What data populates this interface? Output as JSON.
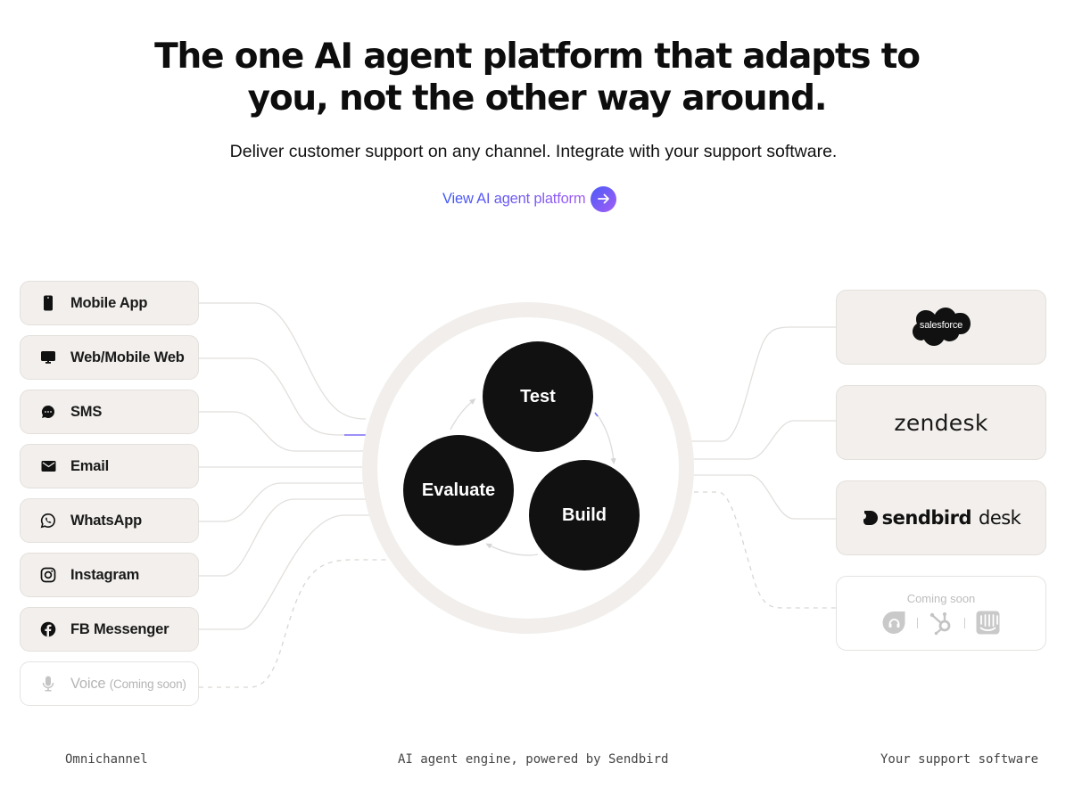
{
  "hero": {
    "title_line1": "The one AI agent platform that adapts to",
    "title_line2": "you, not the other way around.",
    "subtitle": "Deliver customer support on any channel. Integrate with your support software.",
    "cta_label": "View AI agent platform",
    "cta_icon": "arrow-right-icon",
    "cta_gradient": [
      "#3b55f6",
      "#a25cf5"
    ]
  },
  "channels": [
    {
      "label": "Mobile App",
      "icon": "mobile-phone-icon"
    },
    {
      "label": "Web/Mobile Web",
      "icon": "monitor-icon"
    },
    {
      "label": "SMS",
      "icon": "chat-bubble-icon"
    },
    {
      "label": "Email",
      "icon": "envelope-icon"
    },
    {
      "label": "WhatsApp",
      "icon": "whatsapp-icon"
    },
    {
      "label": "Instagram",
      "icon": "instagram-icon"
    },
    {
      "label": "FB Messenger",
      "icon": "facebook-icon"
    },
    {
      "label": "Voice",
      "suffix": "(Coming soon)",
      "icon": "microphone-icon",
      "coming_soon": true
    }
  ],
  "engine": {
    "nodes": [
      "Test",
      "Build",
      "Evaluate"
    ],
    "ring_color": "#f1eeeb",
    "node_color": "#111111"
  },
  "vendors": [
    {
      "label": "salesforce",
      "icon": "salesforce-logo"
    },
    {
      "label": "zendesk",
      "icon": "zendesk-logo"
    },
    {
      "label_bold": "sendbird",
      "label_light": "desk",
      "icon": "sendbird-logo"
    },
    {
      "coming_soon_label": "Coming soon",
      "icons": [
        "freshdesk-icon",
        "hubspot-icon",
        "intercom-icon"
      ],
      "coming_soon": true
    }
  ],
  "captions": {
    "left": "Omnichannel",
    "center": "AI agent engine, powered by Sendbird",
    "right": "Your support software"
  },
  "colors": {
    "card_bg": "#f2efec",
    "card_border": "#e4e0dc",
    "wire": "#e2dfdc",
    "muted": "#b5b5b5"
  }
}
